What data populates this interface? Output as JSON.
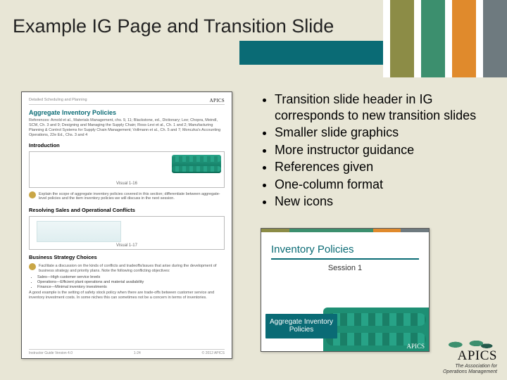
{
  "title": "Example IG Page and Transition Slide",
  "bullets": [
    "Transition slide header in IG corresponds to new transition slides",
    "Smaller slide graphics",
    "More instructor guidance",
    "References given",
    "One-column format",
    "New icons"
  ],
  "ig_page": {
    "course_line": "Detailed Scheduling and Planning",
    "logo": "APICS",
    "section_title": "Aggregate Inventory Policies",
    "references": "References: Arnold et al., Materials Management, chs. 9, 11; Blackstone, ed., Dictionary; Lee; Chopra, Meindl, SCM, Ch. 3 and 9; Designing and Managing the Supply Chain; Ross-Levi et al., Ch. 1 and 2; Manufacturing Planning & Control Systems for Supply Chain Management; Vollmann et al., Ch. 5 and 7; Monczka's Accounting Operations, 22e Ed., Chs. 3 and 4",
    "intro_label": "Introduction",
    "visual1_label": "Visual 1-16",
    "explain_text": "Explain the scope of aggregate inventory policies covered in this section; differentiate between aggregate-level policies and the item inventory policies we will discuss in the next session.",
    "subhead1": "Resolving Sales and Operational Conflicts",
    "visual2_label": "Visual 1-17",
    "subhead2": "Business Strategy Choices",
    "facilitate_text": "Facilitate a discussion on the kinds of conflicts and tradeoffs/issues that arise during the development of business strategy and priority plans. Note the following conflicting objectives:",
    "choice_items": [
      "Sales—High customer service levels",
      "Operations—Efficient plant operations and material availability",
      "Finance—Minimal inventory investments"
    ],
    "closing_text": "A good example is the setting of safety stock policy when there are trade-offs between customer service and inventory investment costs. In some niches this can sometimes not be a concern in terms of inventories.",
    "footer_left": "Instructor Guide Version 4.0",
    "footer_mid": "1-24",
    "footer_right": "© 2012 APICS"
  },
  "transition_slide": {
    "heading": "Inventory Policies",
    "session": "Session 1",
    "label": "Aggregate Inventory Policies",
    "logo": "APICS"
  },
  "brand": {
    "name": "APICS",
    "tagline1": "The Association for",
    "tagline2": "Operations Management"
  }
}
